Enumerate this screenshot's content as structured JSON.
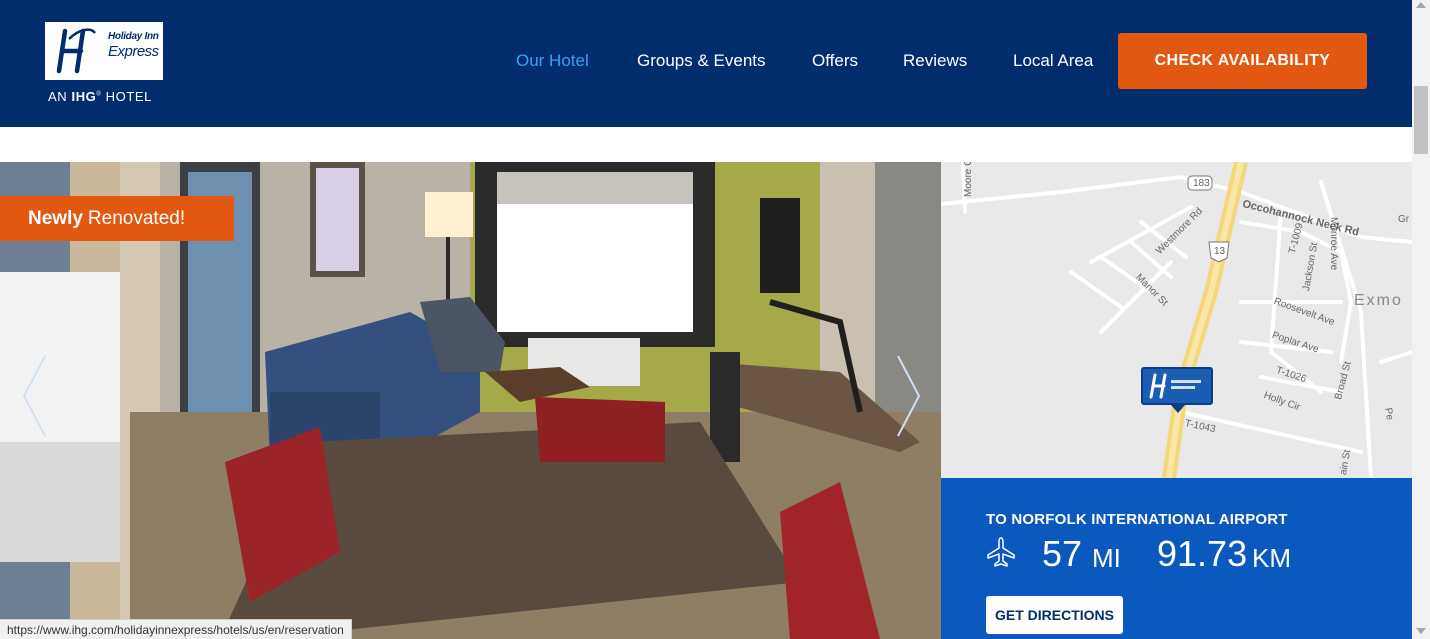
{
  "header": {
    "logo": {
      "brand_line1": "Holiday Inn",
      "brand_line2": "Express",
      "sub_prefix": "AN ",
      "sub_brand": "IHG",
      "sub_mark": "®",
      "sub_suffix": " HOTEL"
    },
    "nav": [
      {
        "label": "Our Hotel",
        "active": true
      },
      {
        "label": "Groups & Events",
        "active": false
      },
      {
        "label": "Offers",
        "active": false
      },
      {
        "label": "Reviews",
        "active": false
      },
      {
        "label": "Local Area",
        "active": false
      }
    ],
    "cta_label": "CHECK AVAILABILITY"
  },
  "hero": {
    "badge_bold": "Newly",
    "badge_text": "Renovated!",
    "prev_icon": "chevron-left-icon",
    "next_icon": "chevron-right-icon"
  },
  "map": {
    "labels": {
      "moore": "Moore C",
      "route183": "183",
      "occohannock": "Occohannock Neck Rd",
      "monroe": "Monroe Ave",
      "gr": "Gr",
      "westmore": "Westmore Rd",
      "route13": "13",
      "t1009": "T-1009",
      "jackson": "Jackson St",
      "manor": "Manor St",
      "exmo": "Exmo",
      "roosevelt": "Roosevelt Ave",
      "poplar": "Poplar Ave",
      "t1026": "T-1026",
      "broad": "Broad St",
      "holly": "Holly Cir",
      "t1043": "T-1043",
      "main": "ain St",
      "pe": "Pe"
    },
    "pin_icon": "hotel-map-pin-icon"
  },
  "airport": {
    "title": "TO NORFOLK INTERNATIONAL AIRPORT",
    "icon": "plane-icon",
    "miles_value": "57",
    "miles_unit": "MI",
    "km_value": "91.73",
    "km_unit": "KM",
    "directions_label": "GET DIRECTIONS"
  },
  "status_url": "https://www.ihg.com/holidayinnexpress/hotels/us/en/reservation",
  "colors": {
    "header_bg": "#022d6d",
    "active_nav": "#36a2ee",
    "accent_orange": "#e25810",
    "airport_bg": "#0b58be"
  }
}
